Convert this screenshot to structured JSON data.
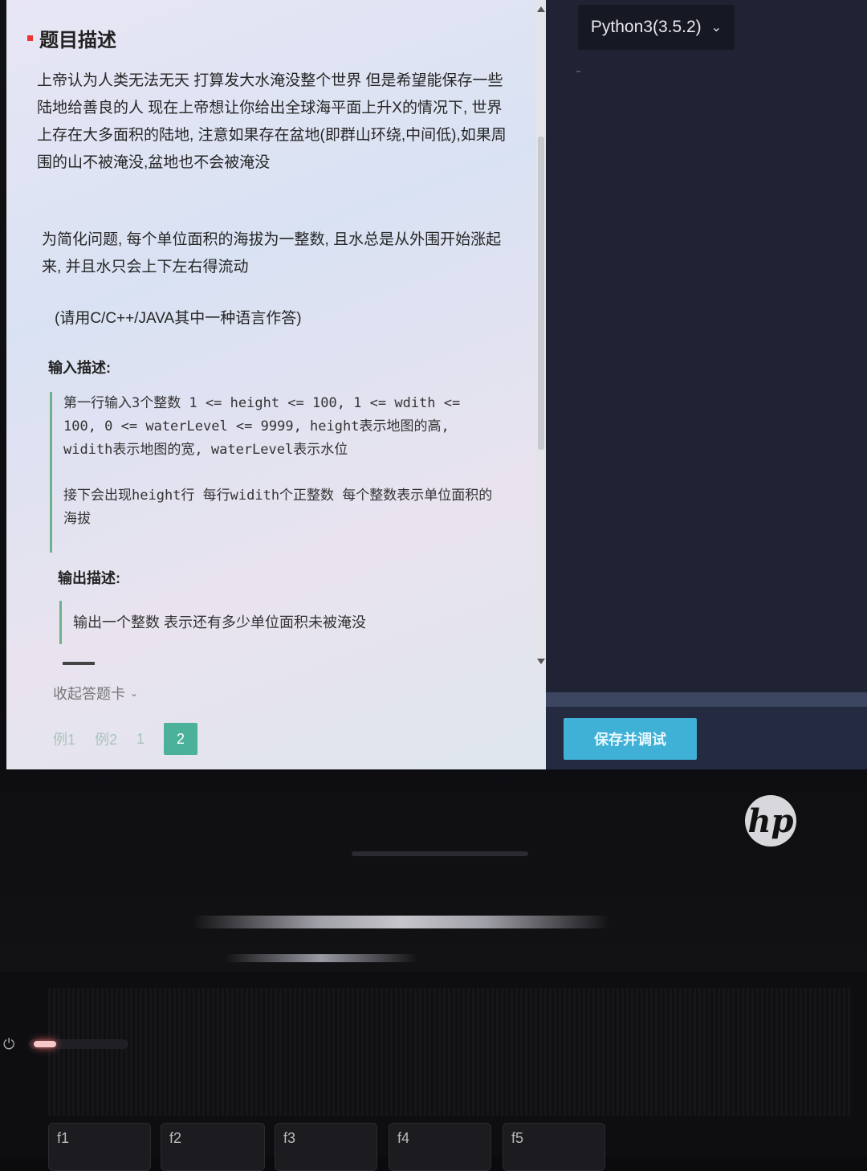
{
  "problem": {
    "title": "题目描述",
    "para1": "上帝认为人类无法无天 打算发大水淹没整个世界 但是希望能保存一些陆地给善良的人 现在上帝想让你给出全球海平面上升X的情况下, 世界上存在大多面积的陆地, 注意如果存在盆地(即群山环绕,中间低),如果周围的山不被淹没,盆地也不会被淹没",
    "para2": "为简化问题, 每个单位面积的海拔为一整数, 且水总是从外围开始涨起来, 并且水只会上下左右得流动",
    "para3": "(请用C/C++/JAVA其中一种语言作答)",
    "input_title": "输入描述:",
    "input_line1": "第一行输入3个整数 1 <= height <= 100, 1 <= wdith <= 100, 0 <= waterLevel <= 9999, height表示地图的高, widith表示地图的宽, waterLevel表示水位",
    "input_line2": "接下会出现height行 每行widith个正整数 每个整数表示单位面积的海拔",
    "output_title": "输出描述:",
    "output_line1": "输出一个整数 表示还有多少单位面积未被淹没"
  },
  "footer": {
    "collapse_label": "收起答题卡",
    "tabs": [
      "例1",
      "例2",
      "1",
      "2"
    ],
    "active_tab": "2"
  },
  "editor": {
    "language": "Python3(3.5.2)",
    "save_label": "保存并调试"
  },
  "laptop": {
    "logo": "hp",
    "keys": [
      "f1",
      "f2",
      "f3",
      "f4",
      "f5"
    ]
  }
}
